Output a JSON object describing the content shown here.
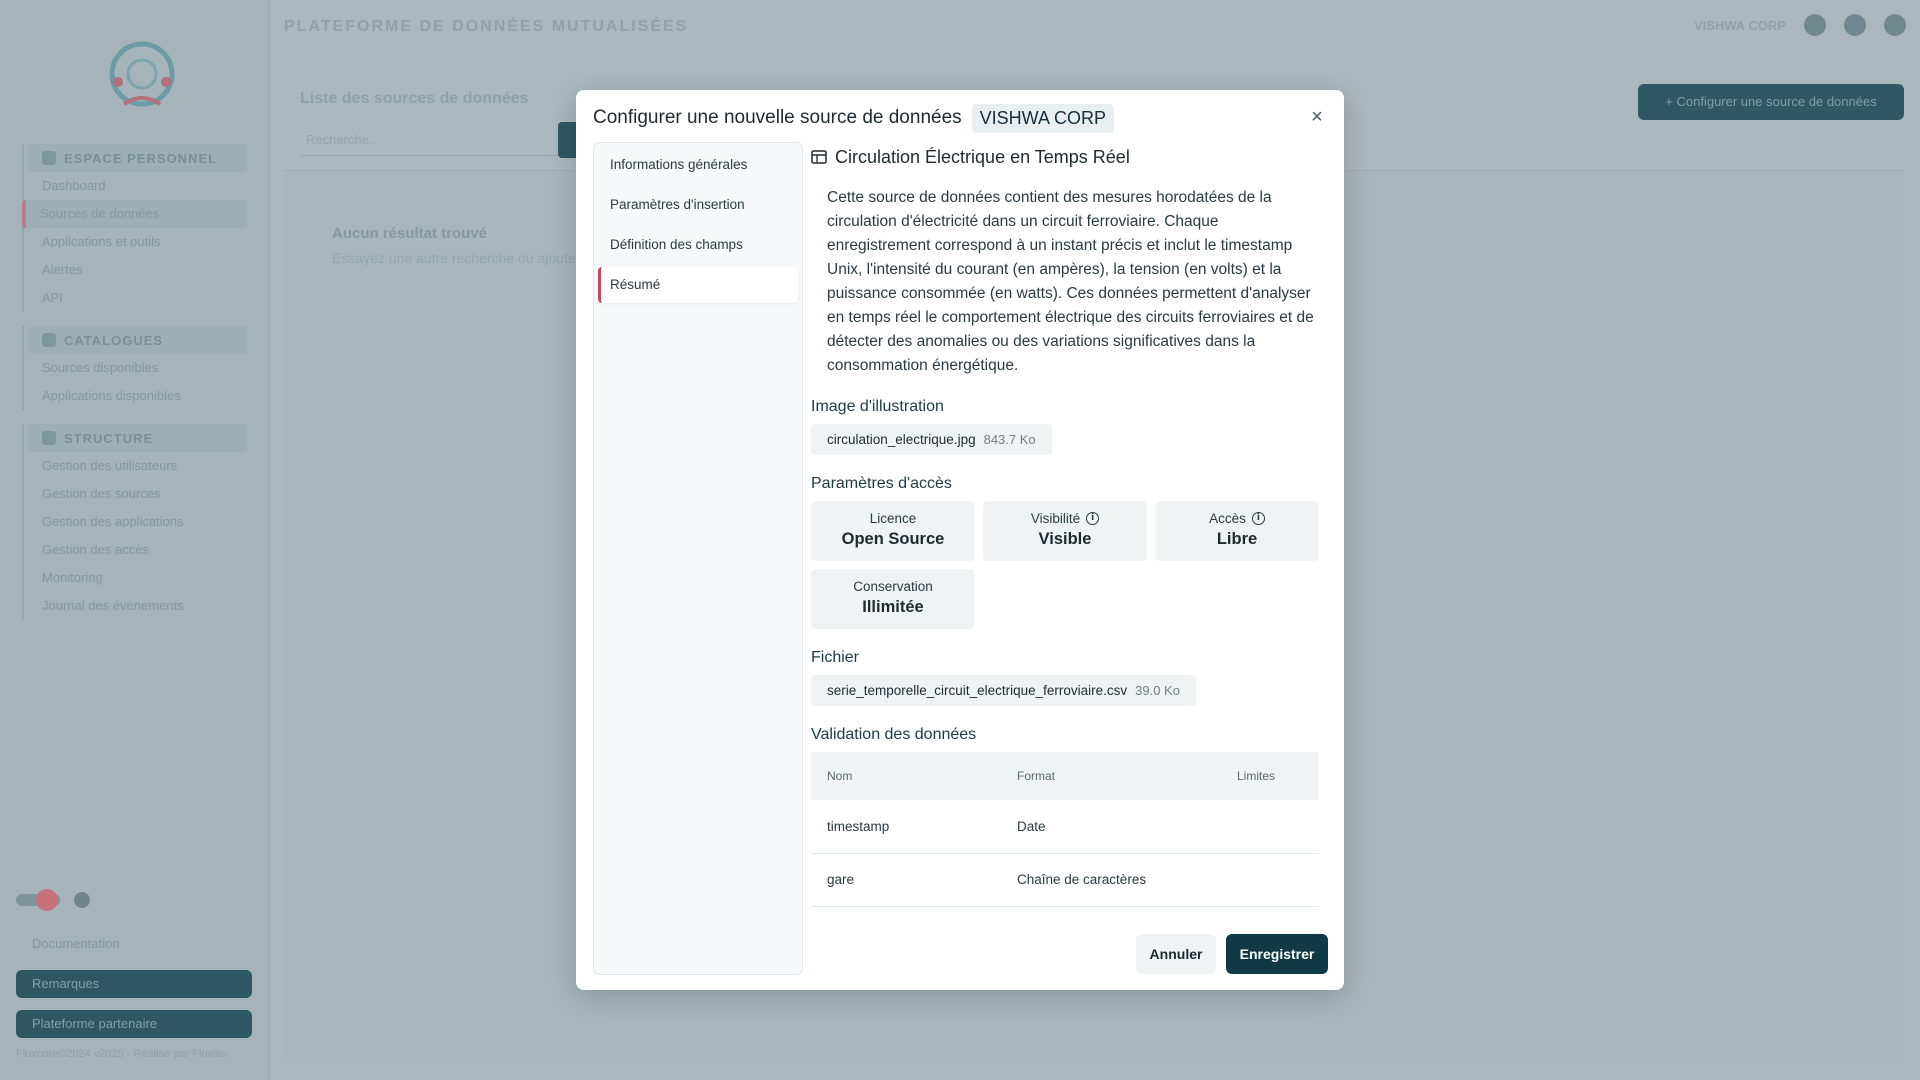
{
  "app": {
    "title": "PLATEFORME DE DONNÉES MUTUALISÉES",
    "user": "VISHWA CORP"
  },
  "sidebar": {
    "groups": [
      {
        "label": "ESPACE PERSONNEL",
        "items": [
          "Dashboard",
          "Sources de données",
          "Applications et outils",
          "Alertes",
          "API"
        ]
      },
      {
        "label": "CATALOGUES",
        "items": [
          "Sources disponibles",
          "Applications disponibles"
        ]
      },
      {
        "label": "STRUCTURE",
        "items": [
          "Gestion des utilisateurs",
          "Gestion des sources",
          "Gestion des applications",
          "Gestion des accès",
          "Monitoring",
          "Journal des évènements"
        ]
      }
    ],
    "links": {
      "docs": "Documentation",
      "feedback": "Remarques",
      "partners": "Plateforme partenaire"
    },
    "footer": "Fluxcore©2024 v2025 - Réalisé par Flowtio"
  },
  "main": {
    "title": "Liste des sources de données",
    "search_placeholder": "Recherche...",
    "cta": "+ Configurer une source de données",
    "empty_title": "Aucun résultat trouvé",
    "empty_sub": "Essayez une autre recherche ou ajoutez une source"
  },
  "modal": {
    "title": "Configurer une nouvelle source de données",
    "org": "VISHWA CORP",
    "close": "×",
    "steps": [
      {
        "label": "Informations générales"
      },
      {
        "label": "Paramètres d'insertion"
      },
      {
        "label": "Définition des champs"
      },
      {
        "label": "Résumé"
      }
    ],
    "summary": {
      "title": "Circulation Électrique en Temps Réel",
      "description": "Cette source de données contient des mesures horodatées de la circulation d'électricité dans un circuit ferroviaire. Chaque enregistrement correspond à un instant précis et inclut le timestamp Unix, l'intensité du courant (en ampères), la tension (en volts) et la puissance consommée (en watts). Ces données permettent d'analyser en temps réel le comportement électrique des circuits ferroviaires et de détecter des anomalies ou des variations significatives dans la consommation énergétique.",
      "image_label": "Image d'illustration",
      "image_file": {
        "name": "circulation_electrique.jpg",
        "size": "843.7 Ko"
      },
      "access_label": "Paramètres d'accès",
      "params": [
        {
          "label": "Licence",
          "value": "Open Source",
          "info": false
        },
        {
          "label": "Visibilité",
          "value": "Visible",
          "info": true
        },
        {
          "label": "Accès",
          "value": "Libre",
          "info": true
        },
        {
          "label": "Conservation",
          "value": "Illimitée",
          "info": false
        }
      ],
      "file_label": "Fichier",
      "file": {
        "name": "serie_temporelle_circuit_electrique_ferroviaire.csv",
        "size": "39.0 Ko"
      },
      "validation_label": "Validation des données",
      "validation_headers": [
        "Nom",
        "Format",
        "Limites"
      ],
      "validation_rows": [
        [
          "timestamp",
          "Date",
          ""
        ],
        [
          "gare",
          "Chaîne de caractères",
          ""
        ]
      ]
    },
    "buttons": {
      "cancel": "Annuler",
      "save": "Enregistrer"
    }
  },
  "colors": {
    "brand": "#0f3945",
    "active_step": "#c8475d",
    "overlay": "#aab8bd"
  }
}
